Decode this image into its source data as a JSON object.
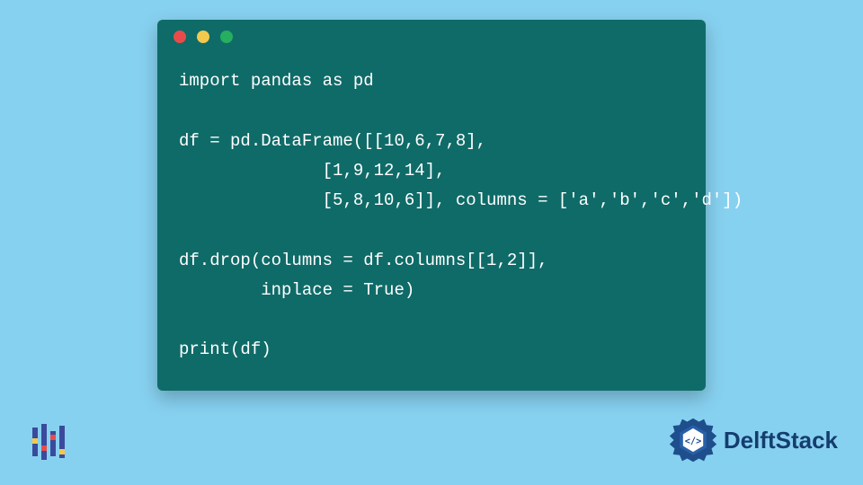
{
  "code": {
    "lines": [
      "import pandas as pd",
      "",
      "df = pd.DataFrame([[10,6,7,8],",
      "              [1,9,12,14],",
      "              [5,8,10,6]], columns = ['a','b','c','d'])",
      "",
      "df.drop(columns = df.columns[[1,2]],",
      "        inplace = True)",
      "",
      "print(df)"
    ]
  },
  "window": {
    "dots": [
      "red",
      "yellow",
      "green"
    ]
  },
  "branding": {
    "right_text": "DelftStack"
  },
  "colors": {
    "background": "#87d1f0",
    "window_bg": "#0f6b68",
    "code_text": "#ffffff",
    "brand_text": "#153d6f"
  }
}
